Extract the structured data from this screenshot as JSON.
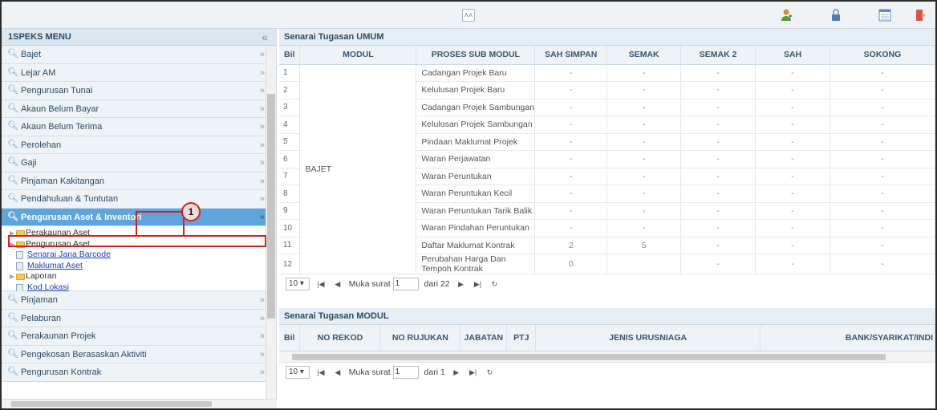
{
  "topbar": {
    "collapse_icon": "double-chevron-up-icon",
    "icons": [
      "user-switch-icon",
      "lock-icon",
      "list-icon",
      "logout-icon"
    ]
  },
  "menu": {
    "title": "1SPEKS MENU",
    "items_top": [
      {
        "label": "Bajet"
      },
      {
        "label": "Lejar AM"
      },
      {
        "label": "Pengurusan Tunai"
      },
      {
        "label": "Akaun Belum Bayar"
      },
      {
        "label": "Akaun Belum Terima"
      },
      {
        "label": "Perolehan"
      },
      {
        "label": "Gaji"
      },
      {
        "label": "Pinjaman Kakitangan"
      },
      {
        "label": "Pendahuluan & Tuntutan"
      }
    ],
    "active_item": {
      "label": "Pengurusan Aset & Inventori"
    },
    "sub_items": {
      "perakaunan_aset": "Perakaunan Aset",
      "pengurusan_aset": "Pengurusan Aset",
      "senarai_jana_barcode": "Senarai Jana Barcode",
      "maklumat_aset": "Maklumat Aset",
      "laporan": "Laporan",
      "kod_lokasi": "Kod Lokasi"
    },
    "items_bottom": [
      {
        "label": "Pinjaman"
      },
      {
        "label": "Pelaburan"
      },
      {
        "label": "Perakaunan Projek"
      },
      {
        "label": "Pengekosan Berasaskan Aktiviti"
      },
      {
        "label": "Pengurusan Kontrak"
      }
    ],
    "callout_number": "1"
  },
  "umum": {
    "title": "Senarai Tugasan UMUM",
    "headers": {
      "bil": "Bil",
      "modul": "MODUL",
      "proses": "PROSES SUB MODUL",
      "sah_simpan": "SAH SIMPAN",
      "semak": "SEMAK",
      "semak2": "SEMAK 2",
      "sah": "SAH",
      "sokong": "SOKONG"
    },
    "modul_value": "BAJET",
    "rows": [
      {
        "bil": "1",
        "proses": "Cadangan Projek Baru",
        "sah_simpan": "-",
        "semak": "-",
        "semak2": "-",
        "sah": "-",
        "sokong": "-"
      },
      {
        "bil": "2",
        "proses": "Kelulusan Projek Baru",
        "sah_simpan": "-",
        "semak": "-",
        "semak2": "-",
        "sah": "-",
        "sokong": "-"
      },
      {
        "bil": "3",
        "proses": "Cadangan Projek Sambungan",
        "sah_simpan": "-",
        "semak": "-",
        "semak2": "-",
        "sah": "-",
        "sokong": "-"
      },
      {
        "bil": "4",
        "proses": "Kelulusan Projek Sambungan",
        "sah_simpan": "-",
        "semak": "-",
        "semak2": "-",
        "sah": "-",
        "sokong": "-"
      },
      {
        "bil": "5",
        "proses": "Pindaan Maklumat Projek",
        "sah_simpan": "-",
        "semak": "-",
        "semak2": "-",
        "sah": "-",
        "sokong": "-"
      },
      {
        "bil": "6",
        "proses": "Waran Perjawatan",
        "sah_simpan": "-",
        "semak": "-",
        "semak2": "-",
        "sah": "-",
        "sokong": "-"
      },
      {
        "bil": "7",
        "proses": "Waran Peruntukan",
        "sah_simpan": "-",
        "semak": "-",
        "semak2": "-",
        "sah": "-",
        "sokong": "-"
      },
      {
        "bil": "8",
        "proses": "Waran Peruntukan Kecil",
        "sah_simpan": "-",
        "semak": "-",
        "semak2": "-",
        "sah": "-",
        "sokong": "-"
      },
      {
        "bil": "9",
        "proses": "Waran Peruntukan Tarik Balik",
        "sah_simpan": "-",
        "semak": "-",
        "semak2": "-",
        "sah": "-",
        "sokong": "-"
      },
      {
        "bil": "10",
        "proses": "Waran Pindahan Peruntukan",
        "sah_simpan": "-",
        "semak": "-",
        "semak2": "-",
        "sah": "-",
        "sokong": "-"
      },
      {
        "bil": "11",
        "proses": "Daftar Maklumat Kontrak",
        "sah_simpan": "2",
        "semak": "5",
        "semak2": "-",
        "sah": "-",
        "sokong": "-"
      },
      {
        "bil": "12",
        "proses": "Perubahan Harga Dan Tempoh Kontrak",
        "sah_simpan": "0",
        "semak": "",
        "semak2": "-",
        "sah": "-",
        "sokong": "-"
      }
    ],
    "pager": {
      "page_size": "10",
      "page_label": "Muka surat",
      "current_page": "1",
      "of_label": "dari 22"
    }
  },
  "modul": {
    "title": "Senarai Tugasan MODUL",
    "headers": {
      "bil": "Bil",
      "no_rekod": "NO REKOD",
      "no_rujukan": "NO RUJUKAN",
      "jabatan": "JABATAN",
      "ptj": "PTJ",
      "jenis_urusniaga": "JENIS URUSNIAGA",
      "bank": "BANK/SYARIKAT/INDI"
    },
    "pager": {
      "page_size": "10",
      "page_label": "Muka surat",
      "current_page": "1",
      "of_label": "dari 1"
    }
  }
}
